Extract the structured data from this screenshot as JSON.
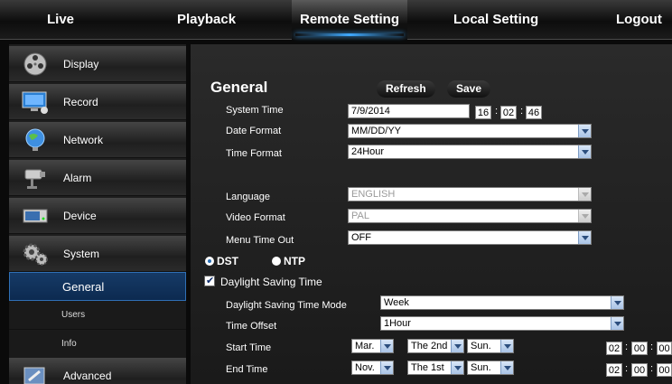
{
  "nav": {
    "live": "Live",
    "playback": "Playback",
    "remote_setting": "Remote Setting",
    "local_setting": "Local Setting",
    "logout": "Logout"
  },
  "sidebar": {
    "items": [
      {
        "label": "Display",
        "icon": "film-reel-icon"
      },
      {
        "label": "Record",
        "icon": "monitor-icon"
      },
      {
        "label": "Network",
        "icon": "globe-icon"
      },
      {
        "label": "Alarm",
        "icon": "alarm-camera-icon"
      },
      {
        "label": "Device",
        "icon": "hard-disk-icon"
      },
      {
        "label": "System",
        "icon": "gears-icon"
      },
      {
        "label": "Advanced",
        "icon": "advanced-tools-icon"
      }
    ],
    "system_sub": {
      "general": "General",
      "users": "Users",
      "info": "Info"
    }
  },
  "main": {
    "title": "General",
    "refresh": "Refresh",
    "save": "Save",
    "system_time_label": "System Time",
    "system_date": "7/9/2014",
    "time_h": "16",
    "time_m": "02",
    "time_s": "46",
    "date_format_label": "Date Format",
    "date_format": "MM/DD/YY",
    "time_format_label": "Time Format",
    "time_format": "24Hour",
    "language_label": "Language",
    "language": "ENGLISH",
    "video_format_label": "Video Format",
    "video_format": "PAL",
    "menu_timeout_label": "Menu Time Out",
    "menu_timeout": "OFF",
    "dst_label": "DST",
    "ntp_label": "NTP",
    "dst_checkbox_label": "Daylight Saving Time",
    "dst_mode_label": "Daylight Saving Time Mode",
    "dst_mode": "Week",
    "time_offset_label": "Time Offset",
    "time_offset": "1Hour",
    "start_time_label": "Start Time",
    "start_month": "Mar.",
    "start_week": "The 2nd",
    "start_day": "Sun.",
    "start_h": "02",
    "start_m": "00",
    "start_s": "00",
    "end_time_label": "End Time",
    "end_month": "Nov.",
    "end_week": "The 1st",
    "end_day": "Sun.",
    "end_h": "02",
    "end_m": "00",
    "end_s": "00"
  }
}
